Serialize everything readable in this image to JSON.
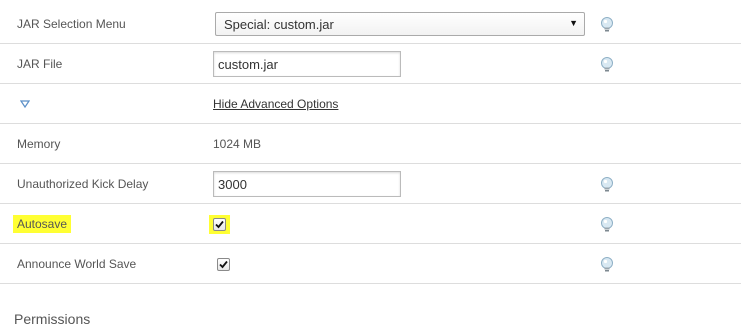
{
  "rows": {
    "jar_selection": {
      "label": "JAR Selection Menu",
      "selected": "Special: custom.jar"
    },
    "jar_file": {
      "label": "JAR File",
      "value": "custom.jar"
    },
    "advanced_toggle": {
      "link": "Hide Advanced Options"
    },
    "memory": {
      "label": "Memory",
      "value": "1024 MB"
    },
    "kick_delay": {
      "label": "Unauthorized Kick Delay",
      "value": "3000"
    },
    "autosave": {
      "label": "Autosave",
      "checked": true
    },
    "announce_world_save": {
      "label": "Announce World Save",
      "checked": true
    }
  },
  "sections": {
    "permissions_title": "Permissions"
  },
  "icons": {
    "help": "lightbulb-help-icon",
    "toggle": "triangle-down-icon",
    "select_caret": "caret-down-icon"
  },
  "colors": {
    "highlight": "#ffff33",
    "divider": "#dddddd",
    "toggle_icon": "#5b8fc7"
  }
}
